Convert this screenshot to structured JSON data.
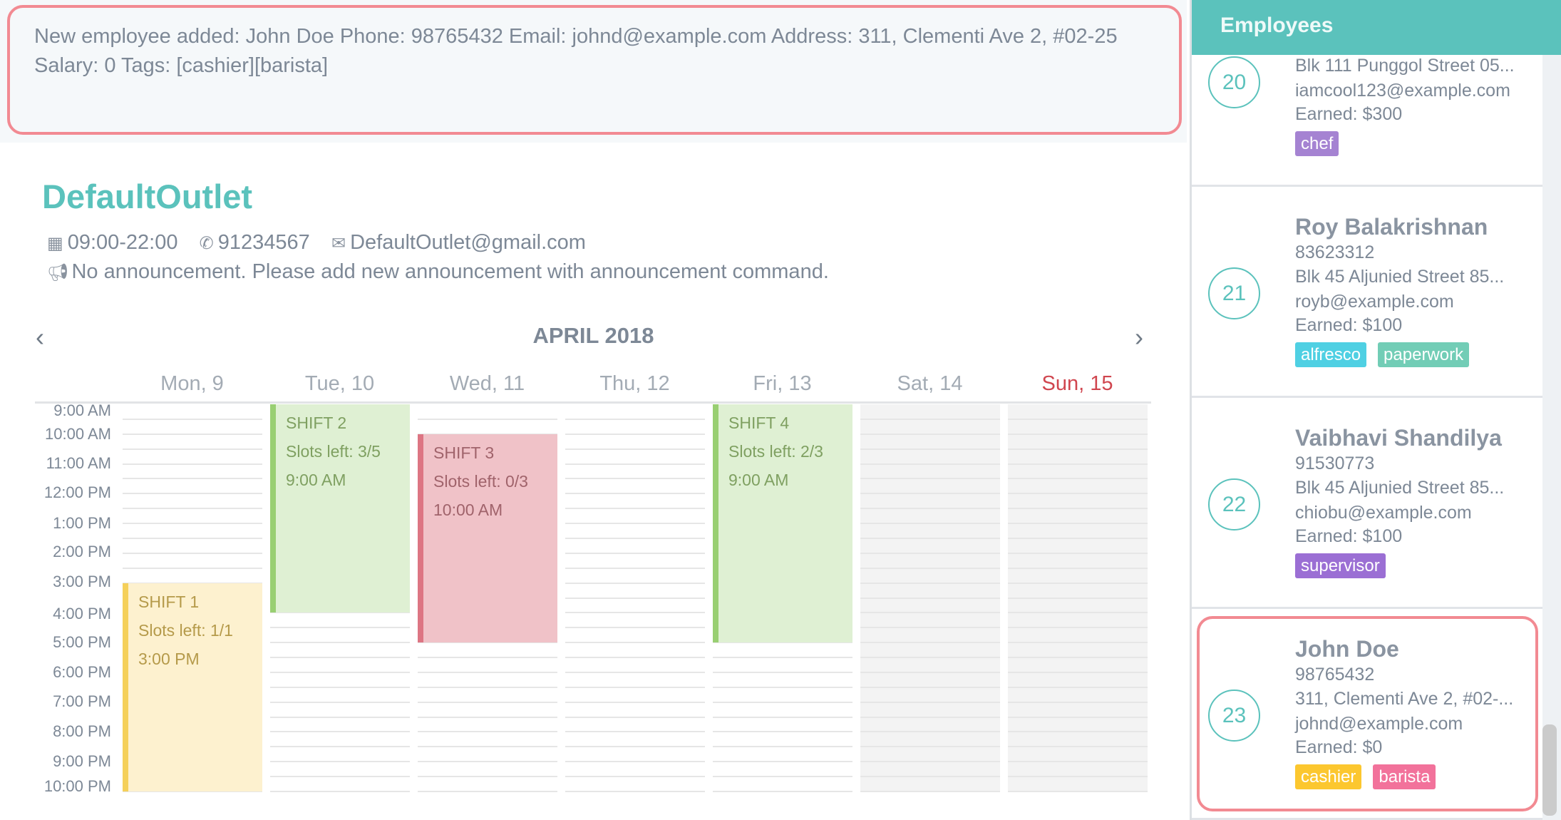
{
  "result": "New employee added: John Doe Phone: 98765432 Email: johnd@example.com Address: 311, Clementi Ave 2, #02-25 Salary: 0 Tags: [cashier][barista]",
  "outlet": {
    "name": "DefaultOutlet",
    "hours": "09:00-22:00",
    "phone": "91234567",
    "email": "DefaultOutlet@gmail.com",
    "announcement": "No announcement. Please add new announcement with announcement command.",
    "icons": [
      "calendar-icon",
      "phone-icon",
      "envelope-icon",
      "megaphone-icon"
    ]
  },
  "calendar": {
    "month": "APRIL 2018",
    "prev": "‹",
    "next": "›",
    "days": [
      "Mon, 9",
      "Tue, 10",
      "Wed, 11",
      "Thu, 12",
      "Fri, 13",
      "Sat, 14",
      "Sun, 15"
    ],
    "times": [
      "9:00 AM",
      "10:00 AM",
      "11:00 AM",
      "12:00 PM",
      "1:00 PM",
      "2:00 PM",
      "3:00 PM",
      "4:00 PM",
      "5:00 PM",
      "6:00 PM",
      "7:00 PM",
      "8:00 PM",
      "9:00 PM",
      "10:00 PM"
    ],
    "shifts": [
      {
        "title": "SHIFT 1",
        "slots": "Slots left: 1/1",
        "time": "3:00 PM",
        "day": 0,
        "start": 15,
        "end": 22,
        "bg": "#fdf1cf",
        "bar": "#f5d05a",
        "fg": "#b59a4a"
      },
      {
        "title": "SHIFT 2",
        "slots": "Slots left: 3/5",
        "time": "9:00 AM",
        "day": 1,
        "start": 9,
        "end": 16,
        "bg": "#dff0d3",
        "bar": "#99cf72",
        "fg": "#7fa061"
      },
      {
        "title": "SHIFT 3",
        "slots": "Slots left: 0/3",
        "time": "10:00 AM",
        "day": 2,
        "start": 10,
        "end": 17,
        "bg": "#f0c2c8",
        "bar": "#dd7583",
        "fg": "#a0636b"
      },
      {
        "title": "SHIFT 4",
        "slots": "Slots left: 2/3",
        "time": "9:00 AM",
        "day": 4,
        "start": 9,
        "end": 17,
        "bg": "#dff0d3",
        "bar": "#99cf72",
        "fg": "#7fa061"
      }
    ]
  },
  "panel": {
    "title": "Employees",
    "employees": [
      {
        "index": "20",
        "address": "Blk 111 Punggol Street 05...",
        "email": "iamcool123@example.com",
        "earned": "Earned: $300",
        "tags": [
          {
            "t": "chef",
            "c": "#a583d2"
          }
        ]
      },
      {
        "index": "21",
        "name": "Roy Balakrishnan",
        "phone": "83623312",
        "address": "Blk 45 Aljunied Street 85...",
        "email": "royb@example.com",
        "earned": "Earned: $100",
        "tags": [
          {
            "t": "alfresco",
            "c": "#4fd0e3"
          },
          {
            "t": "paperwork",
            "c": "#72cdb6"
          }
        ]
      },
      {
        "index": "22",
        "name": "Vaibhavi Shandilya",
        "phone": "91530773",
        "address": "Blk 45 Aljunied Street 85...",
        "email": "chiobu@example.com",
        "earned": "Earned: $100",
        "tags": [
          {
            "t": "supervisor",
            "c": "#9b6fd4"
          }
        ]
      },
      {
        "index": "23",
        "name": "John Doe",
        "phone": "98765432",
        "address": "311, Clementi Ave 2, #02-...",
        "email": "johnd@example.com",
        "earned": "Earned: $0",
        "tags": [
          {
            "t": "cashier",
            "c": "#fcc72f"
          },
          {
            "t": "barista",
            "c": "#f2729b"
          }
        ],
        "selected": true
      }
    ]
  }
}
